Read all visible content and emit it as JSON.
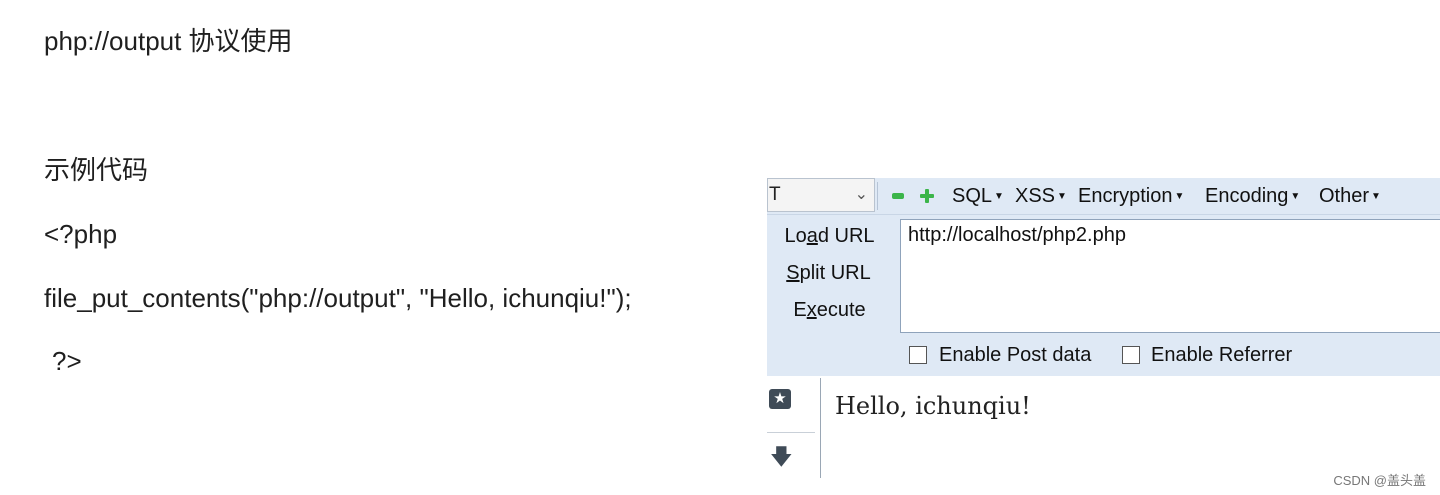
{
  "document": {
    "title": "php://output 协议使用",
    "heading": "示例代码",
    "code_open": "<?php",
    "code_line": "file_put_contents(\"php://output\", \"Hello, ichunqiu!\");",
    "code_close": "?>"
  },
  "hackbar": {
    "select_value": "T",
    "menus": [
      {
        "label": "SQL"
      },
      {
        "label": "XSS"
      },
      {
        "label": "Encryption"
      },
      {
        "label": "Encoding"
      },
      {
        "label": "Other"
      }
    ],
    "actions": {
      "load": {
        "pre": "Lo",
        "key": "a",
        "post": "d URL"
      },
      "split": {
        "pre": "",
        "key": "S",
        "post": "plit URL"
      },
      "execute": {
        "pre": "E",
        "key": "x",
        "post": "ecute"
      }
    },
    "url": "http://localhost/php2.php",
    "checkboxes": {
      "post": {
        "label": "Enable Post data",
        "checked": false
      },
      "referrer": {
        "label": "Enable Referrer",
        "checked": false
      }
    }
  },
  "output_text": "Hello, ichunqiu!",
  "watermark": "CSDN @盖头盖",
  "icons": {
    "toolbar": [
      "minus-icon",
      "plus-icon"
    ],
    "sidebar": [
      "star-icon",
      "down-arrow-icon"
    ]
  },
  "colors": {
    "hackbar_bg": "#dfe9f5",
    "control_green": "#3bb54a"
  }
}
